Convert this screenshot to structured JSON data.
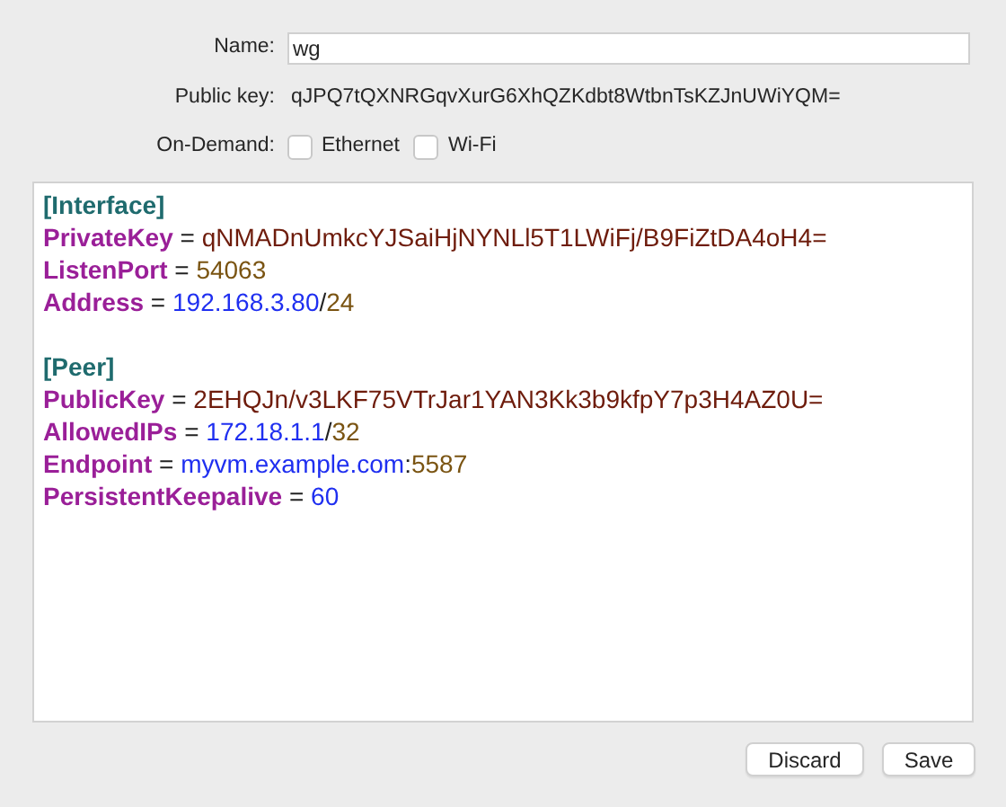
{
  "name_field": {
    "label": "Name:",
    "value": "wg"
  },
  "public_key": {
    "label": "Public key:",
    "value": "qJPQ7tQXNRGqvXurG6XhQZKdbt8WtbnTsKZJnUWiYQM="
  },
  "on_demand": {
    "label": "On-Demand:",
    "options": [
      {
        "label": "Ethernet",
        "checked": false
      },
      {
        "label": "Wi-Fi",
        "checked": false
      }
    ]
  },
  "editor": {
    "lines": [
      [
        {
          "kind": "section",
          "text": "[Interface]"
        }
      ],
      [
        {
          "kind": "key",
          "text": "PrivateKey"
        },
        {
          "kind": "plain",
          "text": " = "
        },
        {
          "kind": "base64",
          "text": "qNMADnUmkcYJSaiHjNYNLl5T1LWiFj/B9FiZtDA4oH4="
        }
      ],
      [
        {
          "kind": "key",
          "text": "ListenPort"
        },
        {
          "kind": "plain",
          "text": " = "
        },
        {
          "kind": "numeric",
          "text": "54063"
        }
      ],
      [
        {
          "kind": "key",
          "text": "Address"
        },
        {
          "kind": "plain",
          "text": " = "
        },
        {
          "kind": "host",
          "text": "192.168.3.80"
        },
        {
          "kind": "plain",
          "text": "/"
        },
        {
          "kind": "numeric",
          "text": "24"
        }
      ],
      [
        {
          "kind": "blank"
        }
      ],
      [
        {
          "kind": "section",
          "text": "[Peer]"
        }
      ],
      [
        {
          "kind": "key",
          "text": "PublicKey"
        },
        {
          "kind": "plain",
          "text": " = "
        },
        {
          "kind": "base64",
          "text": "2EHQJn/v3LKF75VTrJar1YAN3Kk3b9kfpY7p3H4AZ0U="
        }
      ],
      [
        {
          "kind": "key",
          "text": "AllowedIPs"
        },
        {
          "kind": "plain",
          "text": " = "
        },
        {
          "kind": "host",
          "text": "172.18.1.1"
        },
        {
          "kind": "plain",
          "text": "/"
        },
        {
          "kind": "numeric",
          "text": "32"
        }
      ],
      [
        {
          "kind": "key",
          "text": "Endpoint"
        },
        {
          "kind": "plain",
          "text": " = "
        },
        {
          "kind": "host",
          "text": "myvm.example.com"
        },
        {
          "kind": "plain",
          "text": ":"
        },
        {
          "kind": "numeric",
          "text": "5587"
        }
      ],
      [
        {
          "kind": "key",
          "text": "PersistentKeepalive"
        },
        {
          "kind": "plain",
          "text": " = "
        },
        {
          "kind": "host",
          "text": "60"
        }
      ]
    ]
  },
  "buttons": [
    "Discard",
    "Save"
  ]
}
